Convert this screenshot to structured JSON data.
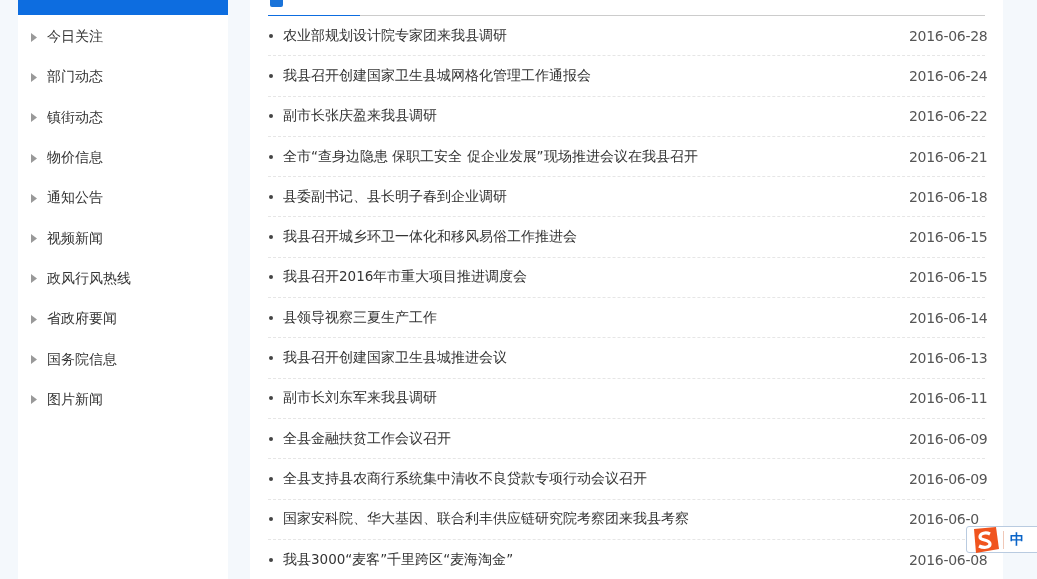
{
  "sidebar": {
    "items": [
      {
        "label": "今日关注"
      },
      {
        "label": "部门动态"
      },
      {
        "label": "镇街动态"
      },
      {
        "label": "物价信息"
      },
      {
        "label": "通知公告"
      },
      {
        "label": "视频新闻"
      },
      {
        "label": "政风行风热线"
      },
      {
        "label": "省政府要闻"
      },
      {
        "label": "国务院信息"
      },
      {
        "label": "图片新闻"
      }
    ]
  },
  "news": [
    {
      "title": "农业部规划设计院专家团来我县调研",
      "date": "2016-06-28"
    },
    {
      "title": "我县召开创建国家卫生县城网格化管理工作通报会",
      "date": "2016-06-24"
    },
    {
      "title": "副市长张庆盈来我县调研",
      "date": "2016-06-22"
    },
    {
      "title": "全市“查身边隐患 保职工安全 促企业发展”现场推进会议在我县召开",
      "date": "2016-06-21"
    },
    {
      "title": "县委副书记、县长明子春到企业调研",
      "date": "2016-06-18"
    },
    {
      "title": "我县召开城乡环卫一体化和移风易俗工作推进会",
      "date": "2016-06-15"
    },
    {
      "title": "我县召开2016年市重大项目推进调度会",
      "date": "2016-06-15"
    },
    {
      "title": "县领导视察三夏生产工作",
      "date": "2016-06-14"
    },
    {
      "title": "我县召开创建国家卫生县城推进会议",
      "date": "2016-06-13"
    },
    {
      "title": "副市长刘东军来我县调研",
      "date": "2016-06-11"
    },
    {
      "title": "全县金融扶贫工作会议召开",
      "date": "2016-06-09"
    },
    {
      "title": "全县支持县农商行系统集中清收不良贷款专项行动会议召开",
      "date": "2016-06-09"
    },
    {
      "title": "国家安科院、华大基因、联合利丰供应链研究院考察团来我县考察",
      "date": "2016-06-0"
    },
    {
      "title": "我县3000“麦客”千里跨区“麦海淘金”",
      "date": "2016-06-08"
    }
  ],
  "ime_bar": {
    "mode": "中"
  }
}
